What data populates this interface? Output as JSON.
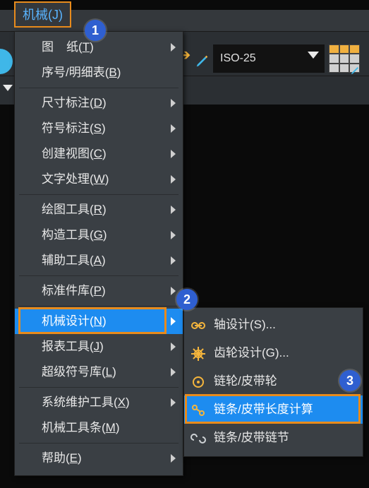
{
  "menubar": {
    "mechanical": "机械(J)"
  },
  "toolbar": {
    "dimstyle": "ISO-25"
  },
  "menu": {
    "items": [
      {
        "pre": "图",
        "post": "纸(",
        "accel": "T",
        "close": ")",
        "sub": true,
        "spaced": true
      },
      {
        "pre": "序号/明细表(",
        "accel": "B",
        "close": ")",
        "sub": false
      },
      {
        "pre": "尺寸标注(",
        "accel": "D",
        "close": ")",
        "sub": true
      },
      {
        "pre": "符号标注(",
        "accel": "S",
        "close": ")",
        "sub": true
      },
      {
        "pre": "创建视图(",
        "accel": "C",
        "close": ")",
        "sub": true
      },
      {
        "pre": "文字处理(",
        "accel": "W",
        "close": ")",
        "sub": true
      },
      {
        "pre": "绘图工具(",
        "accel": "R",
        "close": ")",
        "sub": true
      },
      {
        "pre": "构造工具(",
        "accel": "G",
        "close": ")",
        "sub": true
      },
      {
        "pre": "辅助工具(",
        "accel": "A",
        "close": ")",
        "sub": true
      },
      {
        "pre": "标准件库(",
        "accel": "P",
        "close": ")",
        "sub": true
      },
      {
        "pre": "机械设计(",
        "accel": "N",
        "close": ")",
        "sub": true,
        "highlight": true
      },
      {
        "pre": "报表工具(",
        "accel": "J",
        "close": ")",
        "sub": true
      },
      {
        "pre": "超级符号库(",
        "accel": "L",
        "close": ")",
        "sub": true
      },
      {
        "pre": "系统维护工具(",
        "accel": "X",
        "close": ")",
        "sub": true
      },
      {
        "pre": "机械工具条(",
        "accel": "M",
        "close": ")",
        "sub": false
      },
      {
        "pre": "帮助(",
        "accel": "E",
        "close": ")",
        "sub": true
      }
    ],
    "separators_after": [
      1,
      5,
      8,
      9,
      12,
      14
    ]
  },
  "submenu": {
    "items": [
      {
        "label": "轴设计(S)...",
        "icon": "shaft-icon"
      },
      {
        "label": "齿轮设计(G)...",
        "icon": "gear-icon"
      },
      {
        "label": "链轮/皮带轮",
        "icon": "sprocket-icon"
      },
      {
        "label": "链条/皮带长度计算",
        "icon": "chain-length-icon",
        "highlight": true
      },
      {
        "label": "链条/皮带链节",
        "icon": "chain-link-icon"
      }
    ]
  },
  "badges": {
    "b1": "1",
    "b2": "2",
    "b3": "3"
  }
}
